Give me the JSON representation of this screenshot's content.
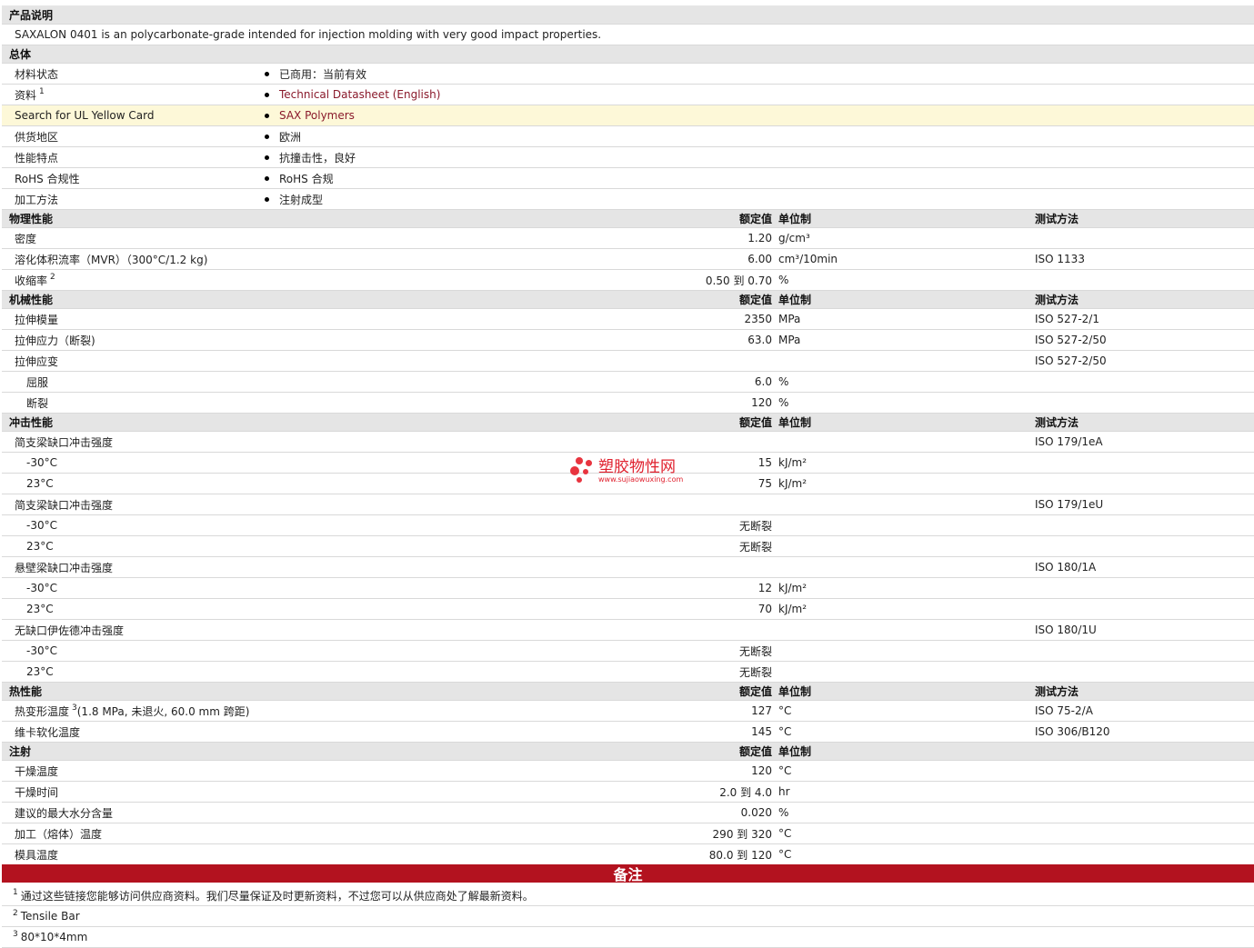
{
  "labels": {
    "rated": "额定值",
    "unit": "单位制",
    "method": "测试方法",
    "to": "到"
  },
  "product": {
    "header": "产品说明",
    "desc": "SAXALON 0401 is an polycarbonate-grade intended for injection molding with very good impact properties."
  },
  "general": {
    "header": "总体",
    "rows": [
      {
        "name": "材料状态",
        "value": "已商用：当前有效"
      },
      {
        "name": "资料",
        "sup": "1",
        "value": "Technical Datasheet (English)",
        "link": true
      },
      {
        "name": "Search for UL Yellow Card",
        "value": "SAX Polymers",
        "link": true,
        "highlight": true
      },
      {
        "name": "供货地区",
        "value": "欧洲"
      },
      {
        "name": "性能特点",
        "value": "抗撞击性，良好"
      },
      {
        "name": "RoHS 合规性",
        "value": "RoHS 合规"
      },
      {
        "name": "加工方法",
        "value": "注射成型"
      }
    ]
  },
  "physical": {
    "header": "物理性能",
    "rows": [
      {
        "name": "密度",
        "value": "1.20",
        "unit": "g/cm³"
      },
      {
        "name": "溶化体积流率（MVR）（300°C/1.2 kg)",
        "value": "6.00",
        "unit": "cm³/10min",
        "method": "ISO 1133"
      },
      {
        "name": "收缩率",
        "sup": "2",
        "value": "0.50 到  0.70",
        "unit": "%"
      }
    ]
  },
  "mechanical": {
    "header": "机械性能",
    "rows": [
      {
        "name": "拉伸模量",
        "value": "2350",
        "unit": "MPa",
        "method": "ISO 527-2/1"
      },
      {
        "name": "拉伸应力（断裂)",
        "value": "63.0",
        "unit": "MPa",
        "method": "ISO 527-2/50"
      },
      {
        "name": "拉伸应变",
        "method": "ISO 527-2/50"
      },
      {
        "name": "屈服",
        "value": "6.0",
        "unit": "%",
        "indent": true
      },
      {
        "name": "断裂",
        "value": "120",
        "unit": "%",
        "indent": true
      }
    ]
  },
  "impact": {
    "header": "冲击性能",
    "rows": [
      {
        "name": "简支梁缺口冲击强度",
        "method": "ISO 179/1eA"
      },
      {
        "name": "-30°C",
        "value": "15",
        "unit": "kJ/m²",
        "indent": true
      },
      {
        "name": "23°C",
        "value": "75",
        "unit": "kJ/m²",
        "indent": true
      },
      {
        "name": "简支梁缺口冲击强度",
        "method": "ISO 179/1eU"
      },
      {
        "name": "-30°C",
        "value": "无断裂",
        "indent": true
      },
      {
        "name": "23°C",
        "value": "无断裂",
        "indent": true
      },
      {
        "name": "悬壁梁缺口冲击强度",
        "method": "ISO 180/1A"
      },
      {
        "name": "-30°C",
        "value": "12",
        "unit": "kJ/m²",
        "indent": true
      },
      {
        "name": "23°C",
        "value": "70",
        "unit": "kJ/m²",
        "indent": true
      },
      {
        "name": "无缺口伊佐德冲击强度",
        "method": "ISO 180/1U"
      },
      {
        "name": "-30°C",
        "value": "无断裂",
        "indent": true
      },
      {
        "name": "23°C",
        "value": "无断裂",
        "indent": true
      }
    ]
  },
  "thermal": {
    "header": "热性能",
    "rows": [
      {
        "name": "热变形温度",
        "sup": "3",
        "suffix": " (1.8 MPa, 未退火, 60.0 mm 跨距)",
        "value": "127",
        "unit": "°C",
        "method": "ISO 75-2/A"
      },
      {
        "name": "维卡软化温度",
        "value": "145",
        "unit": "°C",
        "method": "ISO 306/B120"
      }
    ]
  },
  "injection": {
    "header": "注射",
    "rows": [
      {
        "name": "干燥温度",
        "value": "120",
        "unit": "°C"
      },
      {
        "name": "干燥时间",
        "value": "2.0 到  4.0",
        "unit": "hr"
      },
      {
        "name": "建议的最大水分含量",
        "value": "0.020",
        "unit": "%"
      },
      {
        "name": "加工（熔体）温度",
        "value": "290 到  320",
        "unit": "°C"
      },
      {
        "name": "模具温度",
        "value": "80.0 到  120",
        "unit": "°C"
      }
    ]
  },
  "notes": {
    "header": "备注",
    "items": [
      {
        "num": "1",
        "text": "通过这些链接您能够访问供应商资料。我们尽量保证及时更新资料，不过您可以从供应商处了解最新资料。"
      },
      {
        "num": "2",
        "text": "Tensile Bar"
      },
      {
        "num": "3",
        "text": "80*10*4mm"
      }
    ]
  },
  "watermark": {
    "name": "塑胶物性网",
    "url": "www.sujiaowuxing.com"
  },
  "colors": {
    "header_bg": "#e5e5e5",
    "notes_bar": "#b3121f",
    "link": "#8a1a2b",
    "highlight": "#fdf8d8"
  }
}
